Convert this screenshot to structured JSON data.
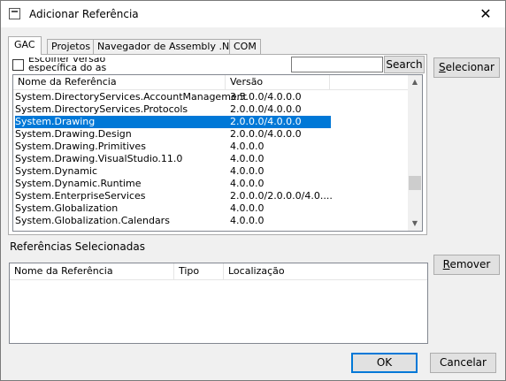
{
  "window": {
    "title": "Adicionar Referência",
    "close_glyph": "✕"
  },
  "tabs": [
    {
      "label": "GAC"
    },
    {
      "label": "Projetos"
    },
    {
      "label": "Navegador de Assembly .NET"
    },
    {
      "label": "COM"
    }
  ],
  "gac": {
    "checkbox_label": "Escolher versão específica do as",
    "search_value": "",
    "search_button": "Search",
    "columns": [
      "Nome da Referência",
      "Versão"
    ],
    "rows": [
      {
        "name": "System.DirectoryServices.AccountManagement",
        "version": "3.5.0.0/4.0.0.0"
      },
      {
        "name": "System.DirectoryServices.Protocols",
        "version": "2.0.0.0/4.0.0.0"
      },
      {
        "name": "System.Drawing",
        "version": "2.0.0.0/4.0.0.0",
        "selected": true
      },
      {
        "name": "System.Drawing.Design",
        "version": "2.0.0.0/4.0.0.0"
      },
      {
        "name": "System.Drawing.Primitives",
        "version": "4.0.0.0"
      },
      {
        "name": "System.Drawing.VisualStudio.11.0",
        "version": "4.0.0.0"
      },
      {
        "name": "System.Dynamic",
        "version": "4.0.0.0"
      },
      {
        "name": "System.Dynamic.Runtime",
        "version": "4.0.0.0"
      },
      {
        "name": "System.EnterpriseServices",
        "version": "2.0.0.0/2.0.0.0/4.0...."
      },
      {
        "name": "System.Globalization",
        "version": "4.0.0.0"
      },
      {
        "name": "System.Globalization.Calendars",
        "version": "4.0.0.0"
      }
    ]
  },
  "buttons": {
    "select": {
      "prefix": "S",
      "rest": "elecionar"
    },
    "remove": {
      "prefix": "R",
      "rest": "emover"
    },
    "ok": "OK",
    "cancel": "Cancelar"
  },
  "selected_refs": {
    "label": "Referências Selecionadas",
    "columns": [
      "Nome da Referência",
      "Tipo",
      "Localização"
    ]
  },
  "scrollbar": {
    "up_glyph": "▲",
    "down_glyph": "▼"
  },
  "icons": {
    "app": "window-icon",
    "close": "close-icon",
    "up": "arrow-up-icon",
    "down": "arrow-down-icon"
  },
  "colors": {
    "selection": "#0078d7",
    "window_bg": "#f0f0f0",
    "button_bg": "#e1e1e1"
  }
}
